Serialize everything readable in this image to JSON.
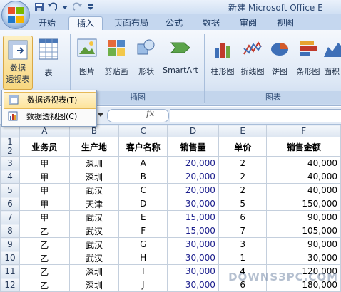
{
  "title": "新建 Microsoft Office E",
  "tabs": [
    {
      "label": "开始"
    },
    {
      "label": "插入"
    },
    {
      "label": "页面布局"
    },
    {
      "label": "公式"
    },
    {
      "label": "数据"
    },
    {
      "label": "审阅"
    },
    {
      "label": "视图"
    }
  ],
  "ribbon": {
    "pivot_label_1": "数据",
    "pivot_label_2": "透视表",
    "table_label": "表",
    "picture_label": "图片",
    "clipart_label": "剪贴画",
    "shapes_label": "形状",
    "smartart_label": "SmartArt",
    "column_label": "柱形图",
    "line_label": "折线图",
    "pie_label": "饼图",
    "bar_label": "条形图",
    "area_label": "面积",
    "group_illustrations": "插图",
    "group_charts": "图表"
  },
  "menu": {
    "item1": "数据透视表(T)",
    "item2": "数据透视图(C)"
  },
  "formula": {
    "fx": "fx"
  },
  "columns": [
    "A",
    "B",
    "C",
    "D",
    "E",
    "F"
  ],
  "header_row": {
    "row": "2",
    "cells": [
      "业务员",
      "生产地",
      "客户名称",
      "销售量",
      "单价",
      "销售金额"
    ]
  },
  "rows": [
    {
      "row": "3",
      "cells": [
        "甲",
        "深圳",
        "A",
        "20,000",
        "2",
        "40,000"
      ]
    },
    {
      "row": "4",
      "cells": [
        "甲",
        "深圳",
        "B",
        "20,000",
        "2",
        "40,000"
      ]
    },
    {
      "row": "5",
      "cells": [
        "甲",
        "武汉",
        "C",
        "20,000",
        "2",
        "40,000"
      ]
    },
    {
      "row": "6",
      "cells": [
        "甲",
        "天津",
        "D",
        "30,000",
        "5",
        "150,000"
      ]
    },
    {
      "row": "7",
      "cells": [
        "甲",
        "武汉",
        "E",
        "15,000",
        "6",
        "90,000"
      ]
    },
    {
      "row": "8",
      "cells": [
        "乙",
        "武汉",
        "F",
        "15,000",
        "7",
        "105,000"
      ]
    },
    {
      "row": "9",
      "cells": [
        "乙",
        "武汉",
        "G",
        "30,000",
        "3",
        "90,000"
      ]
    },
    {
      "row": "10",
      "cells": [
        "乙",
        "武汉",
        "H",
        "30,000",
        "1",
        "30,000"
      ]
    },
    {
      "row": "11",
      "cells": [
        "乙",
        "深圳",
        "I",
        "30,000",
        "4",
        "120,000"
      ]
    },
    {
      "row": "12",
      "cells": [
        "乙",
        "深圳",
        "J",
        "30,000",
        "6",
        "180,000"
      ]
    }
  ],
  "row1": "1",
  "watermark": "DOWNS3PC.COM"
}
